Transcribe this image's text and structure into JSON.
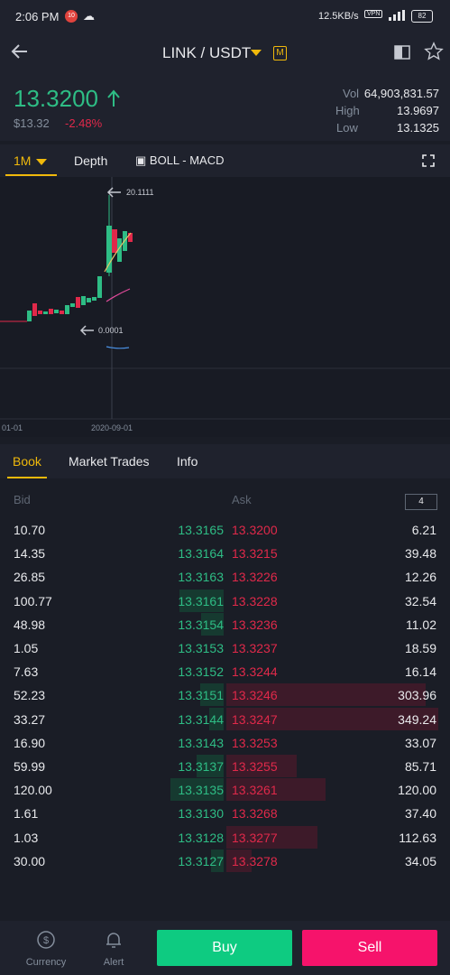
{
  "statusbar": {
    "time": "2:06 PM",
    "badge": "10",
    "speed": "12.5KB/s",
    "vpn": "VPN",
    "battery": "82"
  },
  "header": {
    "pair": "LINK / USDT",
    "margin_badge": "M"
  },
  "ticker": {
    "last_price": "13.3200",
    "usd_price": "$13.32",
    "change": "-2.48%",
    "vol_label": "Vol",
    "vol_value": "64,903,831.57",
    "high_label": "High",
    "high_value": "13.9697",
    "low_label": "Low",
    "low_value": "13.1325"
  },
  "chart_tabs": {
    "interval": "1M",
    "depth": "Depth",
    "indicators": "BOLL - MACD"
  },
  "chart": {
    "high_marker": "20.1111",
    "low_marker": "0.0001",
    "date_left": "01-01",
    "date_right": "2020-09-01"
  },
  "book_tabs": [
    "Book",
    "Market Trades",
    "Info"
  ],
  "orderbook": {
    "bid_header": "Bid",
    "ask_header": "Ask",
    "depth": "4",
    "rows": [
      {
        "bid_qty": "10.70",
        "bid_price": "13.3165",
        "ask_price": "13.3200",
        "ask_qty": "6.21",
        "bid_depth": 0.0,
        "ask_depth": 0.0
      },
      {
        "bid_qty": "14.35",
        "bid_price": "13.3164",
        "ask_price": "13.3215",
        "ask_qty": "39.48",
        "bid_depth": 0.0,
        "ask_depth": 0.0
      },
      {
        "bid_qty": "26.85",
        "bid_price": "13.3163",
        "ask_price": "13.3226",
        "ask_qty": "12.26",
        "bid_depth": 0.0,
        "ask_depth": 0.0
      },
      {
        "bid_qty": "100.77",
        "bid_price": "13.3161",
        "ask_price": "13.3228",
        "ask_qty": "32.54",
        "bid_depth": 0.39,
        "ask_depth": 0.0
      },
      {
        "bid_qty": "48.98",
        "bid_price": "13.3154",
        "ask_price": "13.3236",
        "ask_qty": "11.02",
        "bid_depth": 0.2,
        "ask_depth": 0.0
      },
      {
        "bid_qty": "1.05",
        "bid_price": "13.3153",
        "ask_price": "13.3237",
        "ask_qty": "18.59",
        "bid_depth": 0.0,
        "ask_depth": 0.0
      },
      {
        "bid_qty": "7.63",
        "bid_price": "13.3152",
        "ask_price": "13.3244",
        "ask_qty": "16.14",
        "bid_depth": 0.0,
        "ask_depth": 0.0
      },
      {
        "bid_qty": "52.23",
        "bid_price": "13.3151",
        "ask_price": "13.3246",
        "ask_qty": "303.96",
        "bid_depth": 0.21,
        "ask_depth": 0.94
      },
      {
        "bid_qty": "33.27",
        "bid_price": "13.3144",
        "ask_price": "13.3247",
        "ask_qty": "349.24",
        "bid_depth": 0.13,
        "ask_depth": 1.0
      },
      {
        "bid_qty": "16.90",
        "bid_price": "13.3143",
        "ask_price": "13.3253",
        "ask_qty": "33.07",
        "bid_depth": 0.0,
        "ask_depth": 0.0
      },
      {
        "bid_qty": "59.99",
        "bid_price": "13.3137",
        "ask_price": "13.3255",
        "ask_qty": "85.71",
        "bid_depth": 0.24,
        "ask_depth": 0.33
      },
      {
        "bid_qty": "120.00",
        "bid_price": "13.3135",
        "ask_price": "13.3261",
        "ask_qty": "120.00",
        "bid_depth": 0.47,
        "ask_depth": 0.47
      },
      {
        "bid_qty": "1.61",
        "bid_price": "13.3130",
        "ask_price": "13.3268",
        "ask_qty": "37.40",
        "bid_depth": 0.0,
        "ask_depth": 0.0
      },
      {
        "bid_qty": "1.03",
        "bid_price": "13.3128",
        "ask_price": "13.3277",
        "ask_qty": "112.63",
        "bid_depth": 0.0,
        "ask_depth": 0.43
      },
      {
        "bid_qty": "30.00",
        "bid_price": "13.3127",
        "ask_price": "13.3278",
        "ask_qty": "34.05",
        "bid_depth": 0.11,
        "ask_depth": 0.12
      }
    ]
  },
  "bottombar": {
    "currency": "Currency",
    "alert": "Alert",
    "buy": "Buy",
    "sell": "Sell"
  },
  "colors": {
    "up": "#2ebd85",
    "down": "#e0294a",
    "accent": "#f0b90b",
    "buy": "#0ecb81",
    "sell": "#f6136b"
  }
}
